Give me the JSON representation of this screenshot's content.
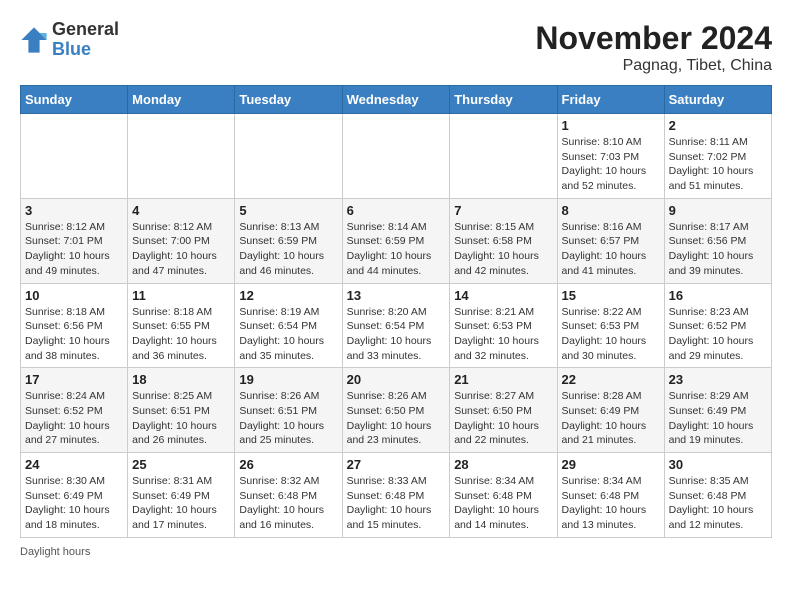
{
  "header": {
    "logo_general": "General",
    "logo_blue": "Blue",
    "title": "November 2024",
    "subtitle": "Pagnag, Tibet, China"
  },
  "weekdays": [
    "Sunday",
    "Monday",
    "Tuesday",
    "Wednesday",
    "Thursday",
    "Friday",
    "Saturday"
  ],
  "weeks": [
    [
      {
        "day": "",
        "info": ""
      },
      {
        "day": "",
        "info": ""
      },
      {
        "day": "",
        "info": ""
      },
      {
        "day": "",
        "info": ""
      },
      {
        "day": "",
        "info": ""
      },
      {
        "day": "1",
        "info": "Sunrise: 8:10 AM\nSunset: 7:03 PM\nDaylight: 10 hours and 52 minutes."
      },
      {
        "day": "2",
        "info": "Sunrise: 8:11 AM\nSunset: 7:02 PM\nDaylight: 10 hours and 51 minutes."
      }
    ],
    [
      {
        "day": "3",
        "info": "Sunrise: 8:12 AM\nSunset: 7:01 PM\nDaylight: 10 hours and 49 minutes."
      },
      {
        "day": "4",
        "info": "Sunrise: 8:12 AM\nSunset: 7:00 PM\nDaylight: 10 hours and 47 minutes."
      },
      {
        "day": "5",
        "info": "Sunrise: 8:13 AM\nSunset: 6:59 PM\nDaylight: 10 hours and 46 minutes."
      },
      {
        "day": "6",
        "info": "Sunrise: 8:14 AM\nSunset: 6:59 PM\nDaylight: 10 hours and 44 minutes."
      },
      {
        "day": "7",
        "info": "Sunrise: 8:15 AM\nSunset: 6:58 PM\nDaylight: 10 hours and 42 minutes."
      },
      {
        "day": "8",
        "info": "Sunrise: 8:16 AM\nSunset: 6:57 PM\nDaylight: 10 hours and 41 minutes."
      },
      {
        "day": "9",
        "info": "Sunrise: 8:17 AM\nSunset: 6:56 PM\nDaylight: 10 hours and 39 minutes."
      }
    ],
    [
      {
        "day": "10",
        "info": "Sunrise: 8:18 AM\nSunset: 6:56 PM\nDaylight: 10 hours and 38 minutes."
      },
      {
        "day": "11",
        "info": "Sunrise: 8:18 AM\nSunset: 6:55 PM\nDaylight: 10 hours and 36 minutes."
      },
      {
        "day": "12",
        "info": "Sunrise: 8:19 AM\nSunset: 6:54 PM\nDaylight: 10 hours and 35 minutes."
      },
      {
        "day": "13",
        "info": "Sunrise: 8:20 AM\nSunset: 6:54 PM\nDaylight: 10 hours and 33 minutes."
      },
      {
        "day": "14",
        "info": "Sunrise: 8:21 AM\nSunset: 6:53 PM\nDaylight: 10 hours and 32 minutes."
      },
      {
        "day": "15",
        "info": "Sunrise: 8:22 AM\nSunset: 6:53 PM\nDaylight: 10 hours and 30 minutes."
      },
      {
        "day": "16",
        "info": "Sunrise: 8:23 AM\nSunset: 6:52 PM\nDaylight: 10 hours and 29 minutes."
      }
    ],
    [
      {
        "day": "17",
        "info": "Sunrise: 8:24 AM\nSunset: 6:52 PM\nDaylight: 10 hours and 27 minutes."
      },
      {
        "day": "18",
        "info": "Sunrise: 8:25 AM\nSunset: 6:51 PM\nDaylight: 10 hours and 26 minutes."
      },
      {
        "day": "19",
        "info": "Sunrise: 8:26 AM\nSunset: 6:51 PM\nDaylight: 10 hours and 25 minutes."
      },
      {
        "day": "20",
        "info": "Sunrise: 8:26 AM\nSunset: 6:50 PM\nDaylight: 10 hours and 23 minutes."
      },
      {
        "day": "21",
        "info": "Sunrise: 8:27 AM\nSunset: 6:50 PM\nDaylight: 10 hours and 22 minutes."
      },
      {
        "day": "22",
        "info": "Sunrise: 8:28 AM\nSunset: 6:49 PM\nDaylight: 10 hours and 21 minutes."
      },
      {
        "day": "23",
        "info": "Sunrise: 8:29 AM\nSunset: 6:49 PM\nDaylight: 10 hours and 19 minutes."
      }
    ],
    [
      {
        "day": "24",
        "info": "Sunrise: 8:30 AM\nSunset: 6:49 PM\nDaylight: 10 hours and 18 minutes."
      },
      {
        "day": "25",
        "info": "Sunrise: 8:31 AM\nSunset: 6:49 PM\nDaylight: 10 hours and 17 minutes."
      },
      {
        "day": "26",
        "info": "Sunrise: 8:32 AM\nSunset: 6:48 PM\nDaylight: 10 hours and 16 minutes."
      },
      {
        "day": "27",
        "info": "Sunrise: 8:33 AM\nSunset: 6:48 PM\nDaylight: 10 hours and 15 minutes."
      },
      {
        "day": "28",
        "info": "Sunrise: 8:34 AM\nSunset: 6:48 PM\nDaylight: 10 hours and 14 minutes."
      },
      {
        "day": "29",
        "info": "Sunrise: 8:34 AM\nSunset: 6:48 PM\nDaylight: 10 hours and 13 minutes."
      },
      {
        "day": "30",
        "info": "Sunrise: 8:35 AM\nSunset: 6:48 PM\nDaylight: 10 hours and 12 minutes."
      }
    ]
  ],
  "footer": "Daylight hours"
}
